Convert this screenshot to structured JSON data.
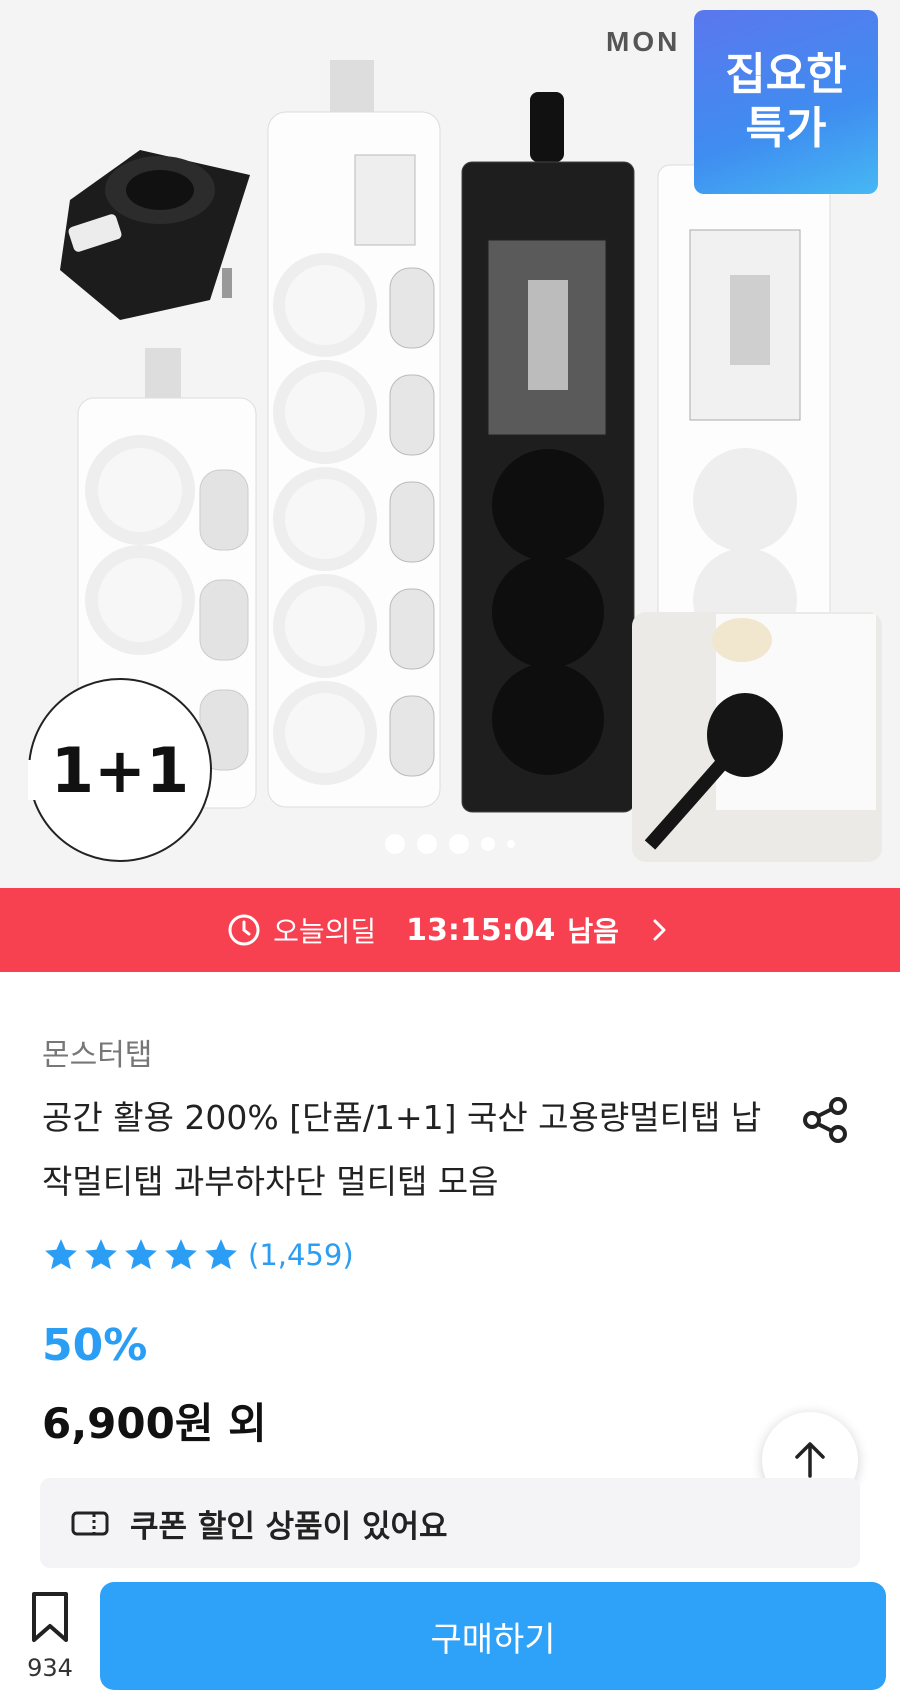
{
  "hero": {
    "brand_text": "MON",
    "sale_badge": [
      "집요한",
      "특가"
    ],
    "plus_badge": "1+1",
    "carousel_dots": 5
  },
  "deal": {
    "label": "오늘의딜",
    "time": "13:15:04",
    "remaining": "남음",
    "icons": {
      "clock": "clock-icon",
      "arrow": "chevron-right-icon"
    },
    "color": "#f74150"
  },
  "product": {
    "seller": "몬스터탭",
    "title": "공간 활용 200% [단품/1+1] 국산 고용량멀티탭 납작멀티탭 과부하차단 멀티탭 모음",
    "rating": {
      "stars": 5,
      "review_count": "(1,459)"
    },
    "discount": "50%",
    "price": "6,900원 외",
    "coupon_text": "쿠폰 할인 상품이 있어요",
    "accent_color": "#2a9df4"
  },
  "bottom_bar": {
    "save_count": "934",
    "buy_label": "구매하기",
    "buy_color": "#2ea1f8"
  }
}
